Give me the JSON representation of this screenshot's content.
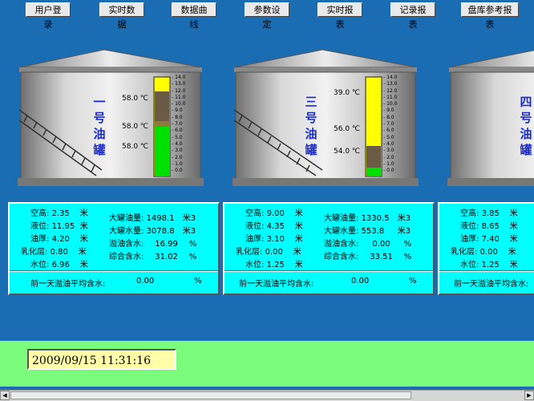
{
  "menu": [
    "用户登录",
    "实时数据",
    "数据曲线",
    "参数设定",
    "实时报表",
    "记录报表",
    "盘库参考报表"
  ],
  "scale_labels": [
    "14.0",
    "13.0",
    "12.0",
    "11.0",
    "10.0",
    "9.0",
    "8.0",
    "7.0",
    "6.0",
    "5.0",
    "4.0",
    "3.0",
    "2.0",
    "1.0",
    "0.0"
  ],
  "tanks": [
    {
      "name": [
        "一",
        "号",
        "油",
        "罐"
      ],
      "temps": [
        "58.0 ℃",
        "58.0 ℃",
        "58.0 ℃"
      ],
      "levels": {
        "total_fraction": 0.86,
        "oil_fraction": 0.3,
        "emul_fraction": 0.06,
        "water_fraction": 0.5
      },
      "space_label": "空高:",
      "space": "2.35",
      "liquid_label": "液位:",
      "liquid": "11.95",
      "oil_label": "油厚:",
      "oil": "4.20",
      "emul_label": "乳化层:",
      "emul": "0.80",
      "water_label": "水位:",
      "water": "6.96",
      "big_oil_label": "大罐油量:",
      "big_oil": "1498.1",
      "big_water_label": "大罐水量:",
      "big_water": "3078.8",
      "overflow_label": "溢油含水:",
      "overflow": "16.99",
      "combined_label": "综合含水:",
      "combined": "31.02",
      "prev_label": "前一天溢油平均含水:",
      "prev": "0.00",
      "pct": "%",
      "m": "米",
      "m3": "米3"
    },
    {
      "name": [
        "三",
        "号",
        "油",
        "罐"
      ],
      "temps": [
        "39.0 ℃",
        "56.0 ℃",
        "54.0 ℃"
      ],
      "levels": {
        "total_fraction": 0.29,
        "oil_fraction": 0.22,
        "emul_fraction": 0.0,
        "water_fraction": 0.08
      },
      "space_label": "空高:",
      "space": "9.00",
      "liquid_label": "液位:",
      "liquid": "4.35",
      "oil_label": "油厚:",
      "oil": "3.10",
      "emul_label": "乳化层:",
      "emul": "0.00",
      "water_label": "水位:",
      "water": "1.25",
      "big_oil_label": "大罐油量:",
      "big_oil": "1330.5",
      "big_water_label": "大罐水量:",
      "big_water": "553.8",
      "overflow_label": "溢油含水:",
      "overflow": "0.00",
      "combined_label": "综合含水:",
      "combined": "33.51",
      "prev_label": "前一天溢油平均含水:",
      "prev": "0.00",
      "pct": "%",
      "m": "米",
      "m3": "米3"
    },
    {
      "name": [
        "四",
        "号",
        "油",
        "罐"
      ],
      "space_label": "空高:",
      "space": "3.85",
      "liquid_label": "液位:",
      "liquid": "8.65",
      "oil_label": "油厚:",
      "oil": "7.40",
      "emul_label": "乳化层:",
      "emul": "0.00",
      "water_label": "水位:",
      "water": "1.25",
      "prev_label": "前一天溢油平均含水:",
      "m": "米"
    }
  ],
  "datetime": "2009/09/15  11:31:16"
}
